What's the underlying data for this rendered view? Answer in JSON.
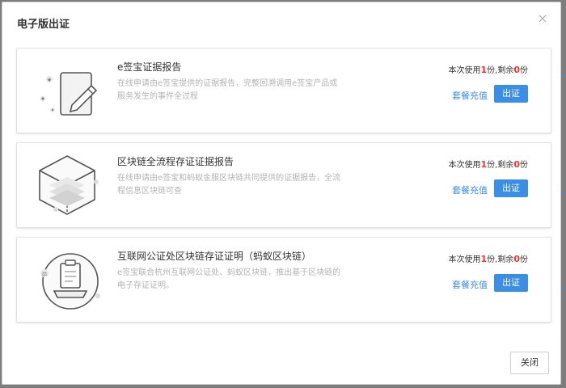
{
  "dialog": {
    "title": "电子版出证",
    "close_button_label": "关闭"
  },
  "cards": [
    {
      "title": "e签宝证据报告",
      "description": "在线申请由e签宝提供的证据报告，完整回溯调用e签宝产品或服务发生的事件全过程",
      "usage_prefix": "本次使用",
      "usage_count": "1",
      "usage_middle": "份,剩余",
      "remaining_count": "0",
      "usage_suffix": "份",
      "recharge_label": "套餐充值",
      "issue_label": "出证",
      "icon": "document-edit-icon"
    },
    {
      "title": "区块链全流程存证证据报告",
      "description": "在线申请由e签宝和蚂蚁金服区块链共同提供的证据报告，全流程信息区块链可查",
      "usage_prefix": "本次使用",
      "usage_count": "1",
      "usage_middle": "份,剩余",
      "remaining_count": "0",
      "usage_suffix": "份",
      "recharge_label": "套餐充值",
      "issue_label": "出证",
      "icon": "blockchain-cube-icon"
    },
    {
      "title": "互联网公证处区块链存证证明（蚂蚁区块链）",
      "description": "e签宝联合杭州互联网公证处、蚂蚁区块链，推出基于区块链的电子存证证明。",
      "usage_prefix": "本次使用",
      "usage_count": "1",
      "usage_middle": "份,剩余",
      "remaining_count": "0",
      "usage_suffix": "份",
      "recharge_label": "套餐充值",
      "issue_label": "出证",
      "icon": "notary-certificate-icon"
    }
  ],
  "colors": {
    "accent": "#3a8ee6",
    "count_highlight": "#ee3333"
  }
}
